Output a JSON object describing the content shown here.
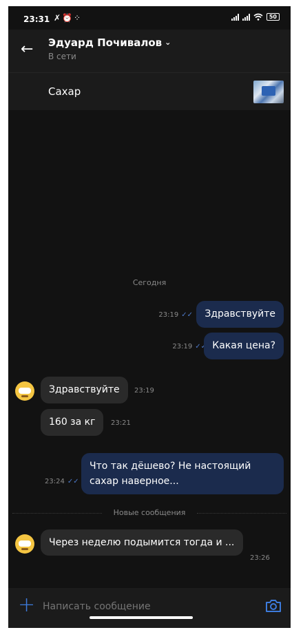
{
  "status_bar": {
    "time": "23:31",
    "battery": "50"
  },
  "header": {
    "contact_name": "Эдуард Почивалов",
    "contact_status": "В сети"
  },
  "product": {
    "title": "Сахар"
  },
  "chat": {
    "date_separator": "Сегодня",
    "new_messages_label": "Новые сообщения",
    "messages": [
      {
        "direction": "out",
        "text": "Здравствуйте",
        "time": "23:19",
        "read": true
      },
      {
        "direction": "out",
        "text": "Какая цена?",
        "time": "23:19",
        "read": true
      },
      {
        "direction": "in",
        "text": "Здравствуйте",
        "time": "23:19"
      },
      {
        "direction": "in",
        "text": "160 за кг",
        "time": "23:21"
      },
      {
        "direction": "out",
        "text": "Что так дёшево? Не настоящий сахар наверное...",
        "time": "23:24",
        "read": true
      },
      {
        "direction": "in",
        "text": "Через неделю подымится тогда и ...",
        "time": "23:26"
      }
    ]
  },
  "composer": {
    "placeholder": "Написать сообщение"
  },
  "colors": {
    "background": "#121212",
    "outgoing_bubble": "#1b2b4d",
    "incoming_bubble": "#2a2a2a",
    "accent": "#3d7bdc",
    "read_check": "#4d79c9"
  }
}
